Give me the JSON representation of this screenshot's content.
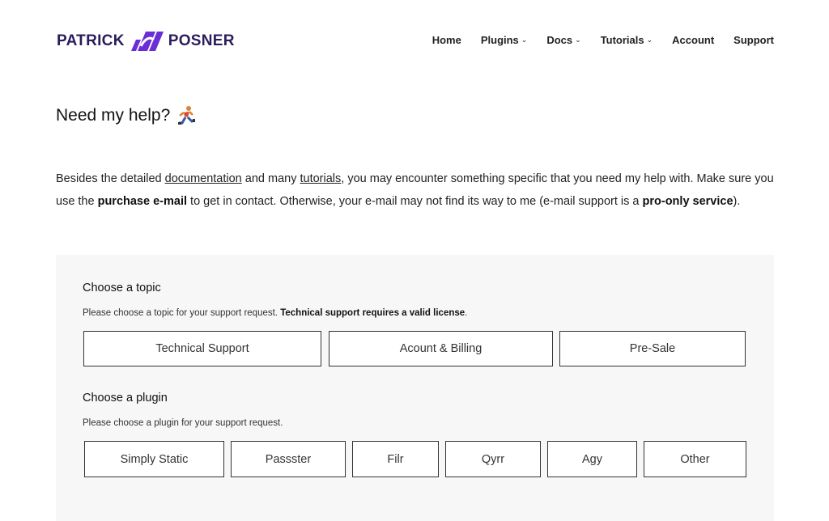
{
  "header": {
    "logo_left": "PATRICK",
    "logo_right": "POSNER",
    "brand_color": "#6b2ed6",
    "nav": [
      {
        "label": "Home",
        "has_dropdown": false
      },
      {
        "label": "Plugins",
        "has_dropdown": true
      },
      {
        "label": "Docs",
        "has_dropdown": true
      },
      {
        "label": "Tutorials",
        "has_dropdown": true
      },
      {
        "label": "Account",
        "has_dropdown": false
      },
      {
        "label": "Support",
        "has_dropdown": false
      }
    ]
  },
  "page": {
    "title": "Need my help?",
    "title_icon": "running-person-icon",
    "intro": {
      "p1": "Besides the detailed ",
      "link_docs": "documentation",
      "p2": " and many ",
      "link_tutorials": "tutorials",
      "p3": ", you may encounter something specific that you need my help with. Make sure you use the ",
      "bold1": "purchase e-mail",
      "p4": " to get in contact. Otherwise, your e-mail may not find its way to me (e-mail support is a ",
      "bold2": "pro-only service",
      "p5": ")."
    }
  },
  "form": {
    "topic": {
      "title": "Choose a topic",
      "desc": "Please choose a topic for your support request. ",
      "desc_bold": "Technical support requires a valid license",
      "desc_end": ".",
      "options": [
        "Technical Support",
        "Acount & Billing",
        "Pre-Sale"
      ]
    },
    "plugin": {
      "title": "Choose a plugin",
      "desc": "Please choose a plugin for your support request.",
      "options": [
        "Simply Static",
        "Passster",
        "Filr",
        "Qyrr",
        "Agy",
        "Other"
      ]
    }
  }
}
